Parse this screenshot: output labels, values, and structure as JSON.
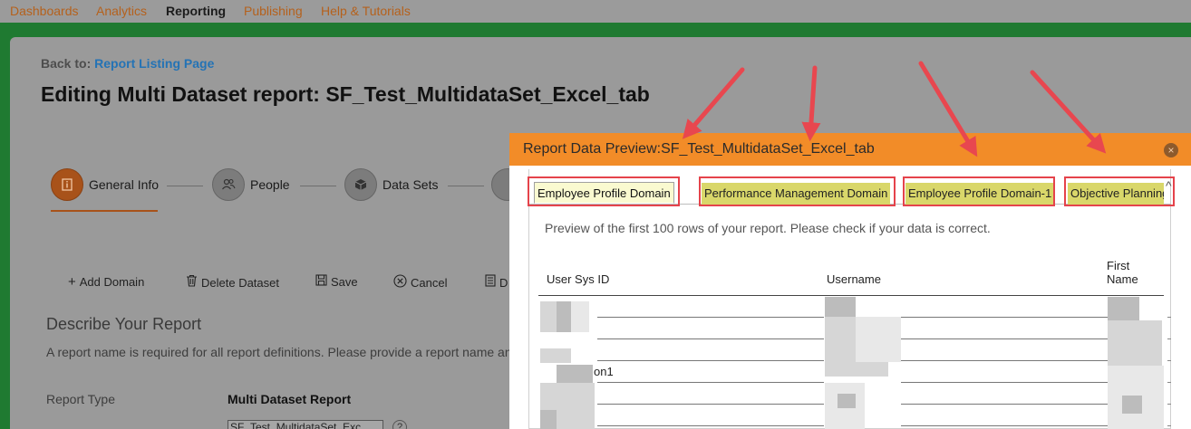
{
  "nav": {
    "items": [
      {
        "label": "Dashboards",
        "active": false
      },
      {
        "label": "Analytics",
        "active": false
      },
      {
        "label": "Reporting",
        "active": true
      },
      {
        "label": "Publishing",
        "active": false
      },
      {
        "label": "Help & Tutorials",
        "active": false
      }
    ]
  },
  "page": {
    "back_prefix": "Back to:",
    "back_link": "Report Listing Page",
    "title": "Editing Multi Dataset report: SF_Test_MultidataSet_Excel_tab"
  },
  "steps": [
    {
      "label": "General Info",
      "icon": "info-icon",
      "active": true
    },
    {
      "label": "People",
      "icon": "people-icon",
      "active": false
    },
    {
      "label": "Data Sets",
      "icon": "cube-icon",
      "active": false
    }
  ],
  "toolbar": {
    "add_domain": "Add Domain",
    "delete_dataset": "Delete Dataset",
    "save": "Save",
    "cancel": "Cancel",
    "partial": "D"
  },
  "describe": {
    "title": "Describe Your Report",
    "desc": "A report name is required for all report definitions. Please provide a report name an",
    "report_type_label": "Report Type",
    "report_type_value": "Multi Dataset Report",
    "name_value": "SF_Test_MultidataSet_Exc"
  },
  "modal": {
    "title": "Report Data Preview:SF_Test_MultidataSet_Excel_tab",
    "close_glyph": "×",
    "tabs": [
      {
        "label": "Employee Profile Domain",
        "active": true
      },
      {
        "label": "Performance Management Domain",
        "active": false
      },
      {
        "label": "Employee Profile Domain-1",
        "active": false
      },
      {
        "label": "Objective Planning",
        "active": false
      }
    ],
    "scroll_glyph": "^",
    "preview_note": "Preview of the first 100 rows of your report. Please check if your data is correct.",
    "columns": [
      "User Sys ID",
      "Username",
      "First Name"
    ],
    "cell_fragment": "on1"
  },
  "colors": {
    "header_orange": "#f28c28",
    "highlight_box": "#e5434b",
    "arrow_red": "#e8474f",
    "active_step": "#a8521a",
    "link_blue": "#2473b5"
  }
}
